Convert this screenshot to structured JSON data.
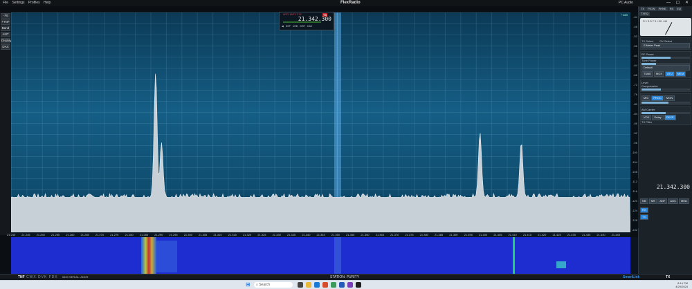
{
  "menu": [
    "File",
    "Settings",
    "Profiles",
    "Help"
  ],
  "app_logo": "FlexRadio",
  "pc_audio": "PC Audio",
  "left_buttons": [
    "- FE",
    "+TNF",
    "Band",
    "ANT",
    "Display",
    "DAX"
  ],
  "panadapter": {
    "ref_label": "+4dB",
    "dbm_ticks": [
      "-44",
      "-48",
      "-52",
      "-56",
      "-60",
      "-64",
      "-68",
      "-72",
      "-76",
      "-80",
      "-84",
      "-88",
      "-92",
      "-96",
      "-100",
      "-104",
      "-108",
      "-112",
      "-116",
      "-120",
      "-124",
      "-128",
      "-132"
    ],
    "freq_ticks": [
      "21.240",
      "21.245",
      "21.250",
      "21.255",
      "21.260",
      "21.265",
      "21.270",
      "21.275",
      "21.280",
      "21.285",
      "21.290",
      "21.295",
      "21.300",
      "21.305",
      "21.310",
      "21.315",
      "21.320",
      "21.325",
      "21.330",
      "21.335",
      "21.340",
      "21.345",
      "21.350",
      "21.355",
      "21.360",
      "21.365",
      "21.370",
      "21.375",
      "21.380",
      "21.385",
      "21.390",
      "21.395",
      "21.400",
      "21.405",
      "21.410",
      "21.415",
      "21.420",
      "21.425",
      "21.430",
      "21.435",
      "21.440",
      "21.445"
    ]
  },
  "vfo_a": {
    "ant": "ANT1 ANT1 2.7K",
    "tx": "TX",
    "frequency": "21.342.300",
    "buttons": [
      "◀",
      "DSP",
      "USB",
      "XRIT",
      "DAX"
    ]
  },
  "right_panel": {
    "tabs": [
      "TX",
      "P/CW",
      "PHNE",
      "RX",
      "EQ",
      "TXEQ",
      "TX"
    ],
    "meter_label": "S Meter Peak",
    "tx_select": "TX Select",
    "rx_select": "RX Select",
    "power_labels": [
      "RF Power",
      "Tune Power"
    ],
    "profile": "Default",
    "tune_buttons": [
      "TUNE",
      "MOX",
      "ATU",
      "MEM"
    ],
    "compression": "Compression",
    "level": "Level",
    "mic": "MIC",
    "proc": "PROC",
    "mon": "MON",
    "am_carrier": "AM Carrier",
    "vox": "VOX",
    "delay": "Delay",
    "dexp": "DEXP",
    "tx_filter": "TX Filter",
    "slice_frequency": "21.342.300",
    "slice_buttons": [
      "NB",
      "NR",
      "ANF",
      "AGC",
      "MED"
    ],
    "rx_buttons": [
      "RX",
      "TX",
      "RX"
    ]
  },
  "status_bar": {
    "tnf": "TNF",
    "modes": "CWX DVK FDX",
    "address": "6400 SERIAL: ADDR",
    "station": "STATION: PURITY",
    "smartlink": "SmartLink",
    "tx": "TX"
  },
  "taskbar": {
    "search_placeholder": "Search",
    "time": "8:14 PM",
    "date": "4/29/2024"
  },
  "chart_data": {
    "type": "area",
    "title": "",
    "xlabel": "",
    "ylabel": "",
    "x_range": [
      21.24,
      21.45
    ],
    "ylim": [
      -132,
      -44
    ],
    "noise_floor_dbm": -118,
    "peaks": [
      {
        "freq": 21.289,
        "dbm": -68
      },
      {
        "freq": 21.291,
        "dbm": -96
      },
      {
        "freq": 21.399,
        "dbm": -92
      },
      {
        "freq": 21.413,
        "dbm": -96
      }
    ],
    "rx_frequency": 21.3423
  }
}
